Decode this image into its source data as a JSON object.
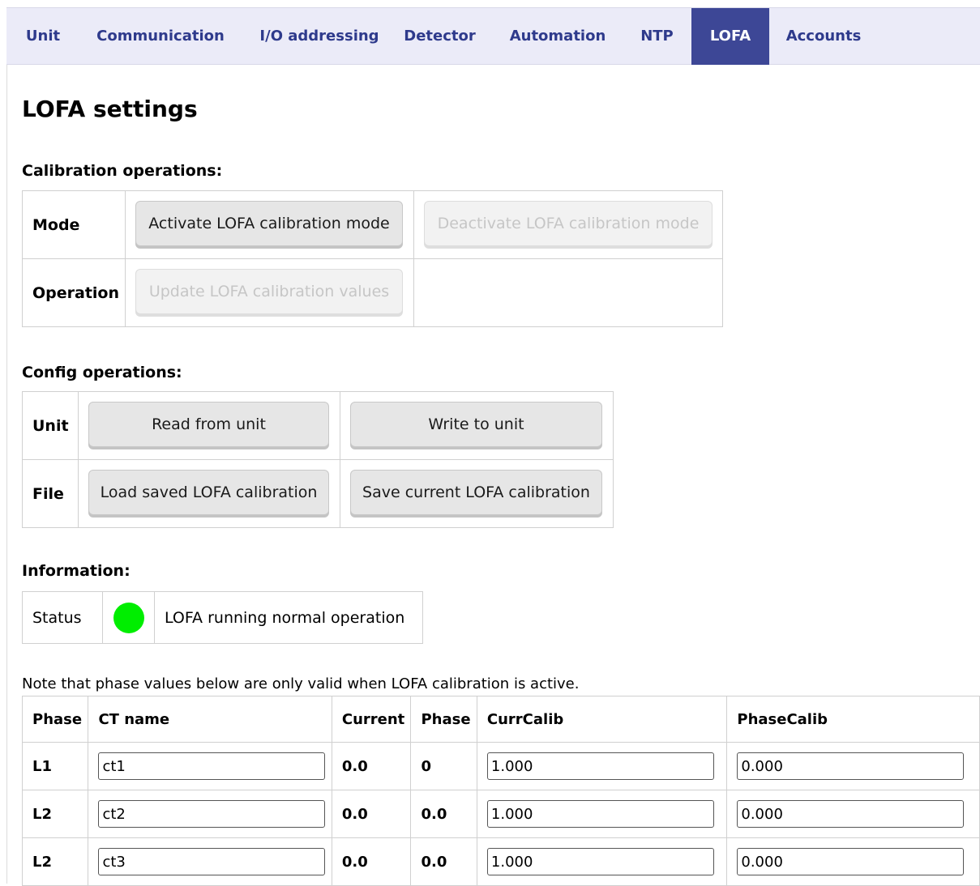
{
  "nav": {
    "tabs": [
      {
        "label": "Unit"
      },
      {
        "label": "Communication"
      },
      {
        "label": "I/O addressing"
      },
      {
        "label": "Detector"
      },
      {
        "label": "Automation"
      },
      {
        "label": "NTP"
      },
      {
        "label": "LOFA",
        "active": true
      },
      {
        "label": "Accounts"
      }
    ]
  },
  "page": {
    "title": "LOFA settings"
  },
  "calibration": {
    "heading": "Calibration operations:",
    "mode_label": "Mode",
    "activate_label": "Activate LOFA calibration mode",
    "deactivate_label": "Deactivate LOFA calibration mode",
    "operation_label": "Operation",
    "update_label": "Update LOFA calibration values"
  },
  "config": {
    "heading": "Config operations:",
    "unit_label": "Unit",
    "read_label": "Read from unit",
    "write_label": "Write to unit",
    "file_label": "File",
    "load_label": "Load saved LOFA calibration",
    "save_label": "Save current LOFA calibration"
  },
  "information": {
    "heading": "Information:",
    "status_label": "Status",
    "status_color": "#00ee00",
    "status_text": "LOFA running normal operation"
  },
  "phase_table": {
    "note": "Note that phase values below are only valid when LOFA calibration is active.",
    "headers": [
      "Phase",
      "CT name",
      "Current",
      "Phase",
      "CurrCalib",
      "PhaseCalib"
    ],
    "rows": [
      {
        "phase": "L1",
        "ct_name": "ct1",
        "current": "0.0",
        "phase_value": "0",
        "curr_calib": "1.000",
        "phase_calib": "0.000"
      },
      {
        "phase": "L2",
        "ct_name": "ct2",
        "current": "0.0",
        "phase_value": "0.0",
        "curr_calib": "1.000",
        "phase_calib": "0.000"
      },
      {
        "phase": "L2",
        "ct_name": "ct3",
        "current": "0.0",
        "phase_value": "0.0",
        "curr_calib": "1.000",
        "phase_calib": "0.000"
      }
    ]
  },
  "colors": {
    "nav_bg": "#ebebf8",
    "nav_active": "#3d4796",
    "nav_text": "#2e3a8c"
  }
}
